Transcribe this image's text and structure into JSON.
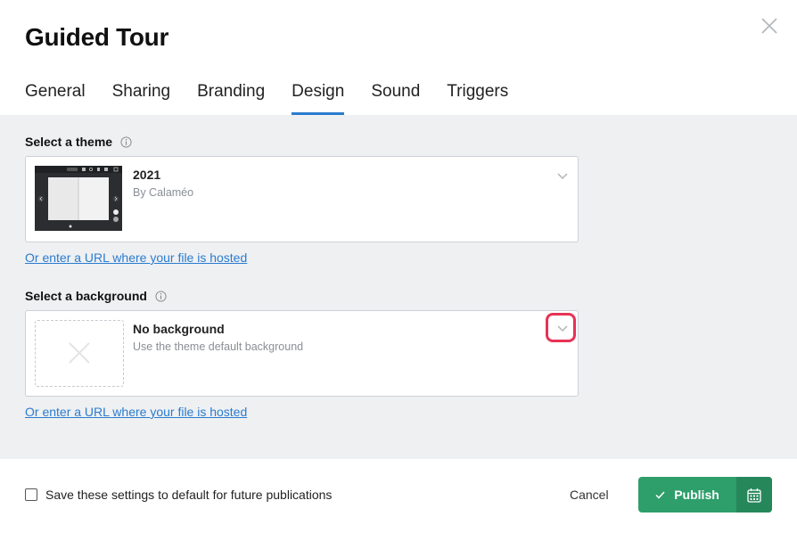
{
  "dialog": {
    "title": "Guided Tour"
  },
  "tabs": [
    {
      "label": "General",
      "active": false
    },
    {
      "label": "Sharing",
      "active": false
    },
    {
      "label": "Branding",
      "active": false
    },
    {
      "label": "Design",
      "active": true
    },
    {
      "label": "Sound",
      "active": false
    },
    {
      "label": "Triggers",
      "active": false
    }
  ],
  "theme": {
    "label": "Select a theme",
    "selected_title": "2021",
    "selected_subtitle": "By Calaméo",
    "url_link": "Or enter a URL where your file is hosted"
  },
  "background": {
    "label": "Select a background",
    "selected_title": "No background",
    "selected_subtitle": "Use the theme default background",
    "url_link": "Or enter a URL where your file is hosted"
  },
  "footer": {
    "checkbox_label": "Save these settings to default for future publications",
    "checkbox_checked": false,
    "cancel_label": "Cancel",
    "publish_label": "Publish"
  },
  "colors": {
    "accent": "#2a7ccf",
    "publish_green": "#2e9e6b",
    "highlight": "#e83256",
    "content_bg": "#eff0f2"
  }
}
